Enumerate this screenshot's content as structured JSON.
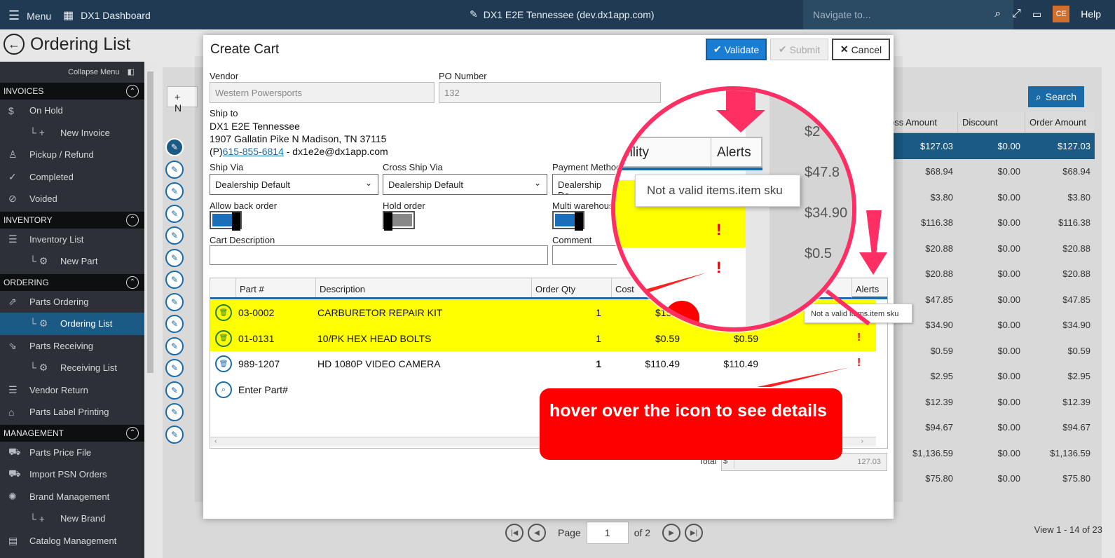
{
  "topbar": {
    "menu_label": "Menu",
    "dashboard_label": "DX1 Dashboard",
    "site_title": "DX1 E2E Tennessee (dev.dx1app.com)",
    "navigate_placeholder": "Navigate to...",
    "user_initials": "CE",
    "help_label": "Help"
  },
  "page": {
    "title": "Ordering List"
  },
  "sidebar": {
    "collapse_label": "Collapse Menu",
    "sections": [
      {
        "title": "INVOICES",
        "items": [
          {
            "label": "On Hold",
            "icon": "dollar-icon",
            "sub": false
          },
          {
            "label": "New Invoice",
            "icon": "plus-icon",
            "sub": true
          },
          {
            "label": "Pickup / Refund",
            "icon": "person-icon",
            "sub": false
          },
          {
            "label": "Completed",
            "icon": "check-icon",
            "sub": false
          },
          {
            "label": "Voided",
            "icon": "void-icon",
            "sub": false
          }
        ]
      },
      {
        "title": "INVENTORY",
        "items": [
          {
            "label": "Inventory List",
            "icon": "list-icon",
            "sub": false
          },
          {
            "label": "New Part",
            "icon": "gear-icon",
            "sub": true
          }
        ]
      },
      {
        "title": "ORDERING",
        "items": [
          {
            "label": "Parts Ordering",
            "icon": "export-icon",
            "sub": false
          },
          {
            "label": "Ordering List",
            "icon": "gear-icon",
            "sub": true,
            "active": true
          },
          {
            "label": "Parts Receiving",
            "icon": "import-icon",
            "sub": false
          },
          {
            "label": "Receiving List",
            "icon": "gear-icon",
            "sub": true
          },
          {
            "label": "Vendor Return",
            "icon": "list-icon",
            "sub": false
          },
          {
            "label": "Parts Label Printing",
            "icon": "tag-icon",
            "sub": false
          }
        ]
      },
      {
        "title": "MANAGEMENT",
        "items": [
          {
            "label": "Parts Price File",
            "icon": "truck-icon",
            "sub": false
          },
          {
            "label": "Import PSN Orders",
            "icon": "truck-icon",
            "sub": false
          },
          {
            "label": "Brand Management",
            "icon": "brand-icon",
            "sub": false
          },
          {
            "label": "New Brand",
            "icon": "plus-icon",
            "sub": true
          },
          {
            "label": "Catalog Management",
            "icon": "book-icon",
            "sub": false
          }
        ]
      }
    ]
  },
  "list": {
    "new_label": "N",
    "search_label": "Search",
    "columns": [
      "oss Amount",
      "Discount",
      "Order Amount"
    ],
    "rows": [
      [
        "$127.03",
        "$0.00",
        "$127.03"
      ],
      [
        "$68.94",
        "$0.00",
        "$68.94"
      ],
      [
        "$3.80",
        "$0.00",
        "$3.80"
      ],
      [
        "$116.38",
        "$0.00",
        "$116.38"
      ],
      [
        "$20.88",
        "$0.00",
        "$20.88"
      ],
      [
        "$20.88",
        "$0.00",
        "$20.88"
      ],
      [
        "$47.85",
        "$0.00",
        "$47.85"
      ],
      [
        "$34.90",
        "$0.00",
        "$34.90"
      ],
      [
        "$0.59",
        "$0.00",
        "$0.59"
      ],
      [
        "$2.95",
        "$0.00",
        "$2.95"
      ],
      [
        "$12.39",
        "$0.00",
        "$12.39"
      ],
      [
        "$94.67",
        "$0.00",
        "$94.67"
      ],
      [
        "$1,136.59",
        "$0.00",
        "$1,136.59"
      ],
      [
        "$75.80",
        "$0.00",
        "$75.80"
      ]
    ],
    "pager": {
      "page_label": "Page",
      "page_value": "1",
      "of_label": "of 2",
      "view_info": "View 1 - 14 of 23"
    }
  },
  "modal": {
    "title": "Create Cart",
    "validate_label": "Validate",
    "submit_label": "Submit",
    "cancel_label": "Cancel",
    "vendor_label": "Vendor",
    "vendor_value": "Western Powersports",
    "po_label": "PO Number",
    "po_value": "132",
    "ship_to_label": "Ship to",
    "ship_to_name": "DX1 E2E Tennessee",
    "ship_to_address": "1907 Gallatin Pike N Madison, TN 37115",
    "phone_prefix": "(P)",
    "phone": "615-855-6814",
    "email": " - dx1e2e@dx1app.com",
    "ship_via_label": "Ship Via",
    "ship_via_value": "Dealership Default",
    "cross_ship_label": "Cross Ship Via",
    "cross_ship_value": "Dealership Default",
    "payment_label": "Payment Method",
    "payment_value": "Dealership De",
    "backorder_label": "Allow back order",
    "hold_label": "Hold order",
    "multi_label": "Multi warehous",
    "cart_desc_label": "Cart Description",
    "comment_label": "Comment",
    "grid": {
      "columns": [
        "Part #",
        "Description",
        "Order Qty",
        "Cost"
      ],
      "alerts_label": "Alerts",
      "rows": [
        {
          "part": "03-0002",
          "desc": "CARBURETOR REPAIR KIT",
          "qty": "1",
          "cost": "$15.5",
          "total": "",
          "alert": "!",
          "highlight": true
        },
        {
          "part": "01-0131",
          "desc": "10/PK HEX HEAD BOLTS",
          "qty": "1",
          "cost": "$0.59",
          "total": "$0.59",
          "alert": "!",
          "highlight": true
        },
        {
          "part": "989-1207",
          "desc": "HD 1080P VIDEO CAMERA",
          "qty": "1",
          "cost": "$110.49",
          "total": "$110.49",
          "alert": "!",
          "highlight": false
        }
      ],
      "enter_placeholder": "Enter Part#"
    },
    "total_label": "Total",
    "total_currency": "$",
    "total_value": "127.03"
  },
  "tooltip": {
    "text": "Not a valid items.item sku",
    "small_text": "Not a valid items.item sku"
  },
  "magnifier": {
    "col_label": "bility",
    "alerts_label": "Alerts",
    "tip": "Not a valid items.item sku",
    "right_values": [
      "$2",
      "$47.8",
      "$34.90",
      "$0.5"
    ],
    "alert": "!"
  },
  "callout": {
    "text": "hover over the icon to see details"
  },
  "colors": {
    "topbar": "#1f3a52",
    "sidebar": "#2d3137",
    "accent": "#1a6aa8",
    "highlight": "#ffff00",
    "callout": "#ff0000",
    "magnifier_ring": "#ff2f64"
  }
}
